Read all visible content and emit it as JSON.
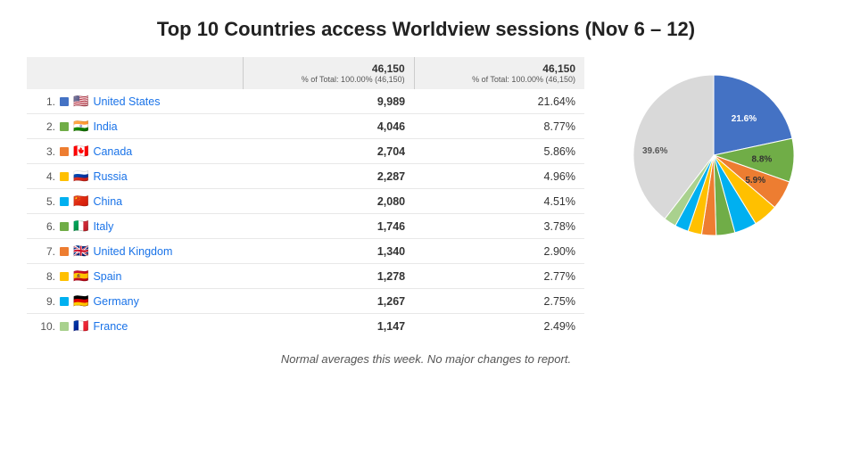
{
  "page": {
    "title": "Top 10 Countries access Worldview sessions (Nov 6 – 12)"
  },
  "table": {
    "col1_header": "",
    "col2_header": "46,150",
    "col2_subtext": "% of Total: 100.00% (46,150)",
    "col3_header": "46,150",
    "col3_subtext": "% of Total: 100.00% (46,150)",
    "rows": [
      {
        "rank": "1.",
        "color": "#4472C4",
        "flag": "US",
        "country": "United States",
        "value": "9,989",
        "pct": "21.64%"
      },
      {
        "rank": "2.",
        "color": "#70AD47",
        "flag": "IN",
        "country": "India",
        "value": "4,046",
        "pct": "8.77%"
      },
      {
        "rank": "3.",
        "color": "#ED7D31",
        "flag": "CA",
        "country": "Canada",
        "value": "2,704",
        "pct": "5.86%"
      },
      {
        "rank": "4.",
        "color": "#FFC000",
        "flag": "RU",
        "country": "Russia",
        "value": "2,287",
        "pct": "4.96%"
      },
      {
        "rank": "5.",
        "color": "#00B0F0",
        "flag": "CN",
        "country": "China",
        "value": "2,080",
        "pct": "4.51%"
      },
      {
        "rank": "6.",
        "color": "#70AD47",
        "flag": "IT",
        "country": "Italy",
        "value": "1,746",
        "pct": "3.78%"
      },
      {
        "rank": "7.",
        "color": "#ED7D31",
        "flag": "GB",
        "country": "United Kingdom",
        "value": "1,340",
        "pct": "2.90%"
      },
      {
        "rank": "8.",
        "color": "#FFC000",
        "flag": "ES",
        "country": "Spain",
        "value": "1,278",
        "pct": "2.77%"
      },
      {
        "rank": "9.",
        "color": "#00B0F0",
        "flag": "DE",
        "country": "Germany",
        "value": "1,267",
        "pct": "2.75%"
      },
      {
        "rank": "10.",
        "color": "#A9D18E",
        "flag": "FR",
        "country": "France",
        "value": "1,147",
        "pct": "2.49%"
      }
    ]
  },
  "chart": {
    "segments": [
      {
        "label": "21.6%",
        "color": "#4472C4",
        "value": 21.64
      },
      {
        "label": "8.8%",
        "color": "#70AD47",
        "value": 8.77
      },
      {
        "label": "5.9%",
        "color": "#ED7D31",
        "value": 5.86
      },
      {
        "label": "5.0%",
        "color": "#FFC000",
        "value": 4.96
      },
      {
        "label": "4.5%",
        "color": "#00B0F0",
        "value": 4.51
      },
      {
        "label": "3.8%",
        "color": "#70AD47",
        "value": 3.78
      },
      {
        "label": "2.9%",
        "color": "#ED7D31",
        "value": 2.9
      },
      {
        "label": "2.8%",
        "color": "#FFC000",
        "value": 2.77
      },
      {
        "label": "2.8%",
        "color": "#00B0F0",
        "value": 2.75
      },
      {
        "label": "2.5%",
        "color": "#A9D18E",
        "value": 2.49
      },
      {
        "label": "39.6%",
        "color": "#D9D9D9",
        "value": 39.57
      }
    ]
  },
  "footer": {
    "note": "Normal averages this week.  No major changes to report."
  }
}
